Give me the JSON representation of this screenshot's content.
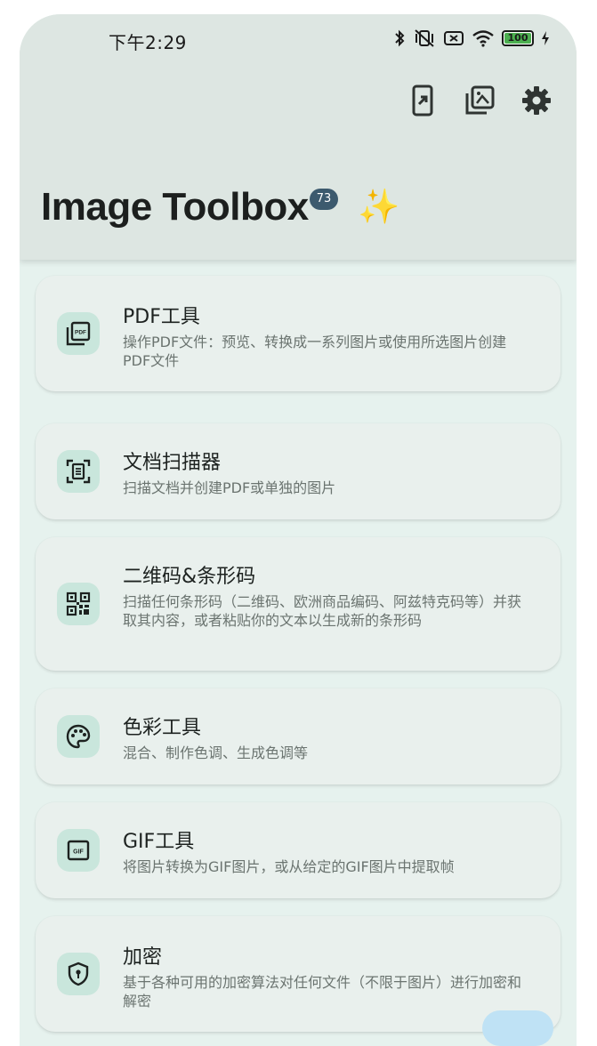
{
  "status": {
    "time": "下午2:29",
    "battery": "100"
  },
  "app": {
    "title": "Image Toolbox",
    "version_badge": "73",
    "sparkle": "✨"
  },
  "actions": [
    {
      "icon": "open-in-app-icon"
    },
    {
      "icon": "photo-library-icon"
    },
    {
      "icon": "settings-icon"
    }
  ],
  "tools": [
    {
      "title": "PDF工具",
      "desc": "操作PDF文件：预览、转换成一系列图片或使用所选图片创建PDF文件",
      "icon": "pdf-icon"
    },
    {
      "title": "文档扫描器",
      "desc": "扫描文档并创建PDF或单独的图片",
      "icon": "document-scanner-icon"
    },
    {
      "title": "二维码&条形码",
      "desc": "扫描任何条形码（二维码、欧洲商品编码、阿兹特克码等）并获取其内容，或者粘贴你的文本以生成新的条形码",
      "icon": "qr-code-icon"
    },
    {
      "title": "色彩工具",
      "desc": "混合、制作色调、生成色调等",
      "icon": "palette-icon"
    },
    {
      "title": "GIF工具",
      "desc": "将图片转换为GIF图片，或从给定的GIF图片中提取帧",
      "icon": "gif-icon"
    },
    {
      "title": "加密",
      "desc": "基于各种可用的加密算法对任何文件（不限于图片）进行加密和解密",
      "icon": "shield-lock-icon"
    }
  ],
  "colors": {
    "background": "#e6f2ee",
    "header": "#dde6e2",
    "card": "#e9f0ed",
    "icon_container": "#c9e6dc",
    "badge": "#3c5a6e"
  }
}
